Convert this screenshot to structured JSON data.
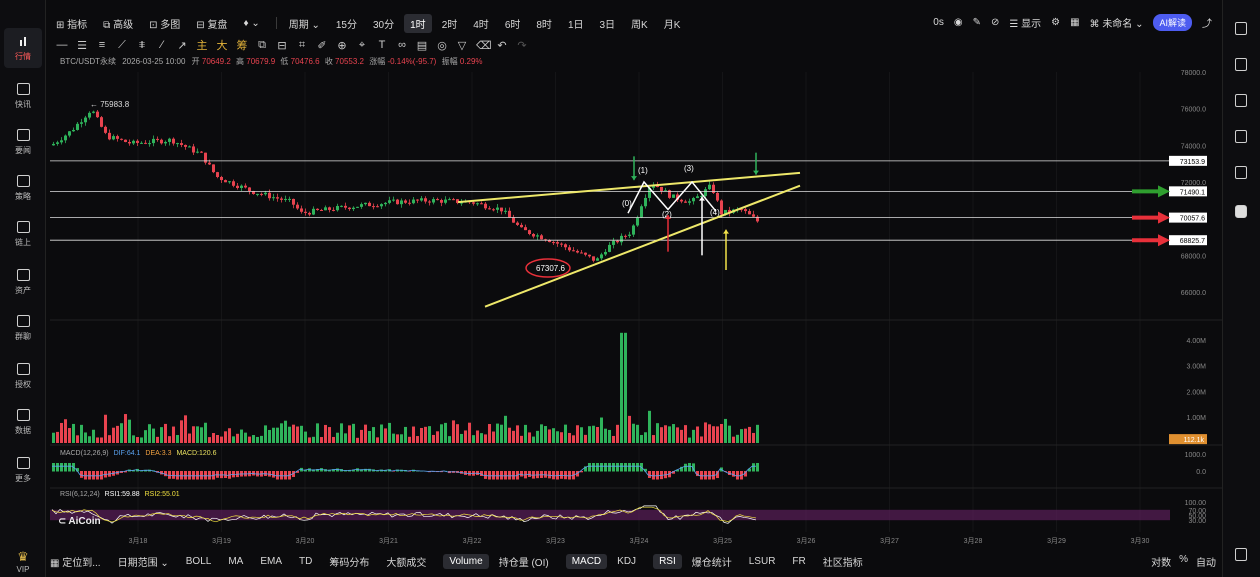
{
  "nav": {
    "items": [
      {
        "label": "行情",
        "active": true
      },
      {
        "label": "快讯"
      },
      {
        "label": "要闻"
      },
      {
        "label": "策略"
      },
      {
        "label": "链上"
      },
      {
        "label": "资产"
      },
      {
        "label": "群聊"
      },
      {
        "label": "授权"
      },
      {
        "label": "数据"
      },
      {
        "label": "更多"
      }
    ],
    "vip": "VIP"
  },
  "toolbar": {
    "indicator": "指标",
    "advanced": "高级",
    "multi": "多图",
    "replay": "复盘",
    "period": "周期",
    "timeframes": [
      "15分",
      "30分",
      "1时",
      "2时",
      "4时",
      "6时",
      "8时",
      "1日",
      "3日",
      "周K",
      "月K"
    ],
    "selected_timeframe": "1时",
    "latency": "0s",
    "display": "显示",
    "unnamed": "未命名",
    "ai_button": "AI解读"
  },
  "drawing_tools": {
    "main": "主",
    "big": "大",
    "fan": "筹"
  },
  "chart": {
    "header": {
      "symbol": "BTC/USDT永续",
      "time": "2026-03-25 10:00",
      "open_label": "开",
      "open": "70649.2",
      "high_label": "高",
      "high": "70679.9",
      "low_label": "低",
      "low": "70476.6",
      "close_label": "收",
      "close": "70553.2",
      "change_label": "涨幅",
      "change": "-0.14%(-95.7)",
      "amplitude_label": "振幅",
      "amplitude": "0.29%"
    },
    "price_axis": [
      "78000.0",
      "76000.0",
      "74000.0",
      "72000.0",
      "70000.0",
      "68000.0",
      "66000.0"
    ],
    "price_lines": [
      {
        "label": "73153.9",
        "value": 73153.9
      },
      {
        "label": "71490.1",
        "value": 71490.1
      },
      {
        "label": "70057.6",
        "value": 70057.6
      },
      {
        "label": "68825.7",
        "value": 68825.7
      }
    ],
    "annotations": {
      "high_marker": "← 75983.8",
      "low_marker": "67307.6",
      "wave0": "(0)",
      "wave1": "(1)",
      "wave2": "(2)",
      "wave3": "(3)",
      "wave4": "(4)"
    },
    "arrow_colors": {
      "green": "#2f9e2f",
      "red": "#e8303a",
      "yellow": "#f3e24a",
      "white": "#ffffff"
    },
    "volume_axis": [
      "4.00M",
      "3.00M",
      "2.00M",
      "1.00M"
    ],
    "volume_last": "112.1k",
    "volume_spike_fraction": 0.95,
    "macd_label": "MACD(12,26,9)",
    "macd_dif": "DIF:64.1",
    "macd_dea": "DEA:3.3",
    "macd_value": "MACD:120.6",
    "macd_axis": [
      "1000.0",
      "0.0"
    ],
    "rsi_label": "RSI(6,12,24)",
    "rsi1": "RSI1:59.88",
    "rsi2": "RSI2:55.01",
    "rsi_axis": [
      "100.00",
      "70.00",
      "50.00",
      "30.00"
    ],
    "watermark": "AiCoin",
    "date_axis": [
      "3月18",
      "3月19",
      "3月20",
      "3月21",
      "3月22",
      "3月23",
      "3月24",
      "3月25",
      "3月26",
      "3月27",
      "3月28",
      "3月29",
      "3月30"
    ]
  },
  "bottom": {
    "locate": "定位到...",
    "date_range": "日期范围",
    "indicators": [
      "BOLL",
      "MA",
      "EMA",
      "TD",
      "筹码分布",
      "大额成交",
      "Volume",
      "持仓量 (OI)",
      "MACD",
      "KDJ",
      "RSI",
      "爆仓统计",
      "LSUR",
      "FR",
      "社区指标"
    ],
    "selected": [
      "Volume",
      "MACD",
      "RSI"
    ],
    "right": [
      "对数",
      "%",
      "自动"
    ]
  }
}
